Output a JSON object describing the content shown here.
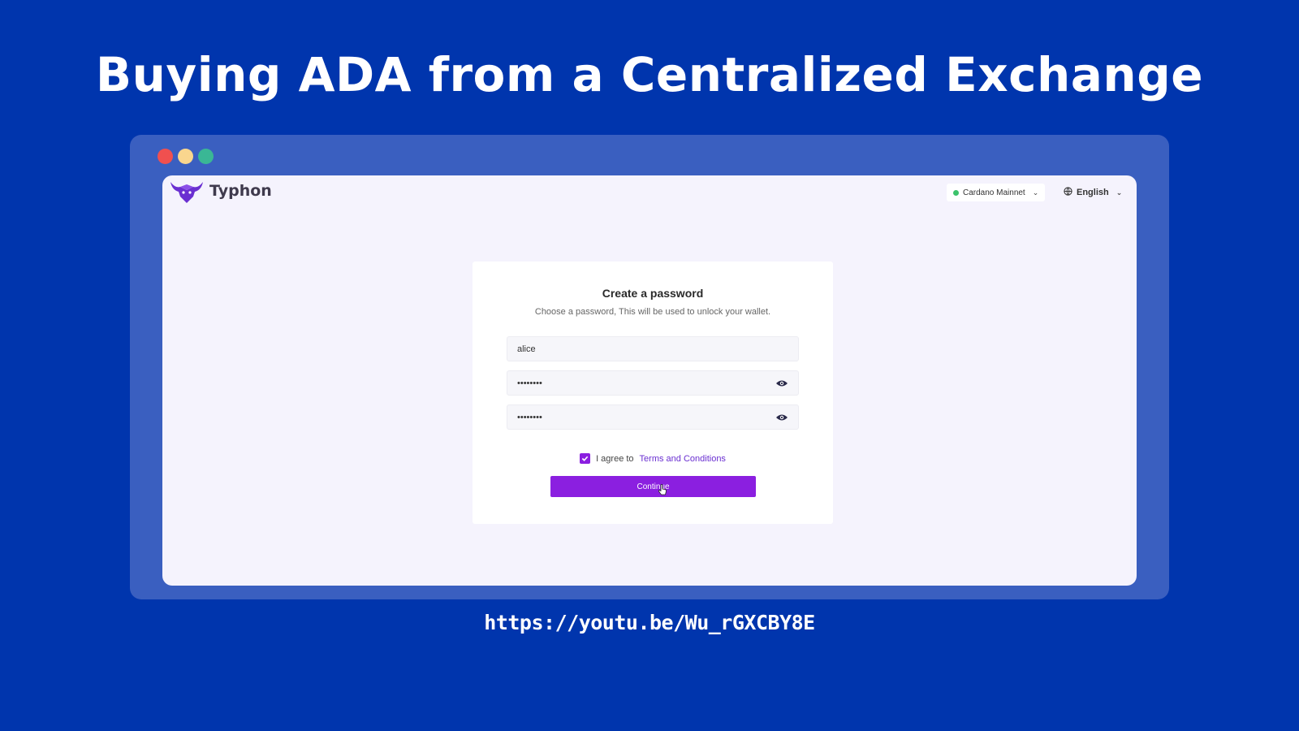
{
  "slide": {
    "title": "Buying ADA from a Centralized Exchange",
    "link": "https://youtu.be/Wu_rGXCBY8E"
  },
  "window_controls": {
    "colors": {
      "close": "#f0504f",
      "minimize": "#f9d68e",
      "maximize": "#3ab795"
    }
  },
  "app": {
    "brand": "Typhon",
    "network": {
      "label": "Cardano Mainnet",
      "status_color": "#3cc36b"
    },
    "language": {
      "label": "English"
    }
  },
  "form": {
    "title": "Create a password",
    "subtitle": "Choose a password, This will be used to unlock your wallet.",
    "name_value": "alice",
    "password_value": "••••••••",
    "confirm_password_value": "••••••••",
    "agree_text": "I agree to",
    "terms_link": "Terms and Conditions",
    "agree_checked": true,
    "continue_label": "Continue"
  },
  "colors": {
    "background": "#0035ad",
    "frame": "#3a5fc0",
    "accent": "#8b1fe0",
    "link": "#6a2fd1"
  }
}
